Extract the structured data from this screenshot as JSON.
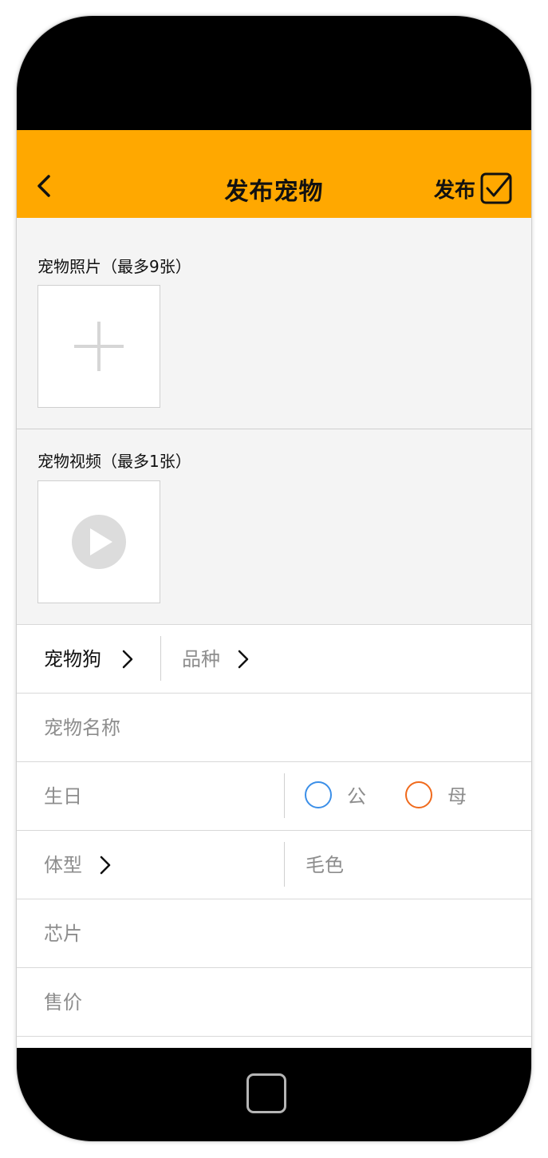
{
  "header": {
    "title": "发布宠物",
    "publish_label": "发布"
  },
  "photos": {
    "title": "宠物照片（最多9张）"
  },
  "video": {
    "title": "宠物视频（最多1张）"
  },
  "form": {
    "pet_type": "宠物狗",
    "breed": "品种",
    "name_placeholder": "宠物名称",
    "birthday": "生日",
    "gender_male": "公",
    "gender_female": "母",
    "body_type": "体型",
    "coat_color": "毛色",
    "chip": "芯片",
    "price": "售价"
  },
  "colors": {
    "accent": "#ffa800",
    "male_radio": "#3b8fe8",
    "female_radio": "#f06a1c"
  }
}
